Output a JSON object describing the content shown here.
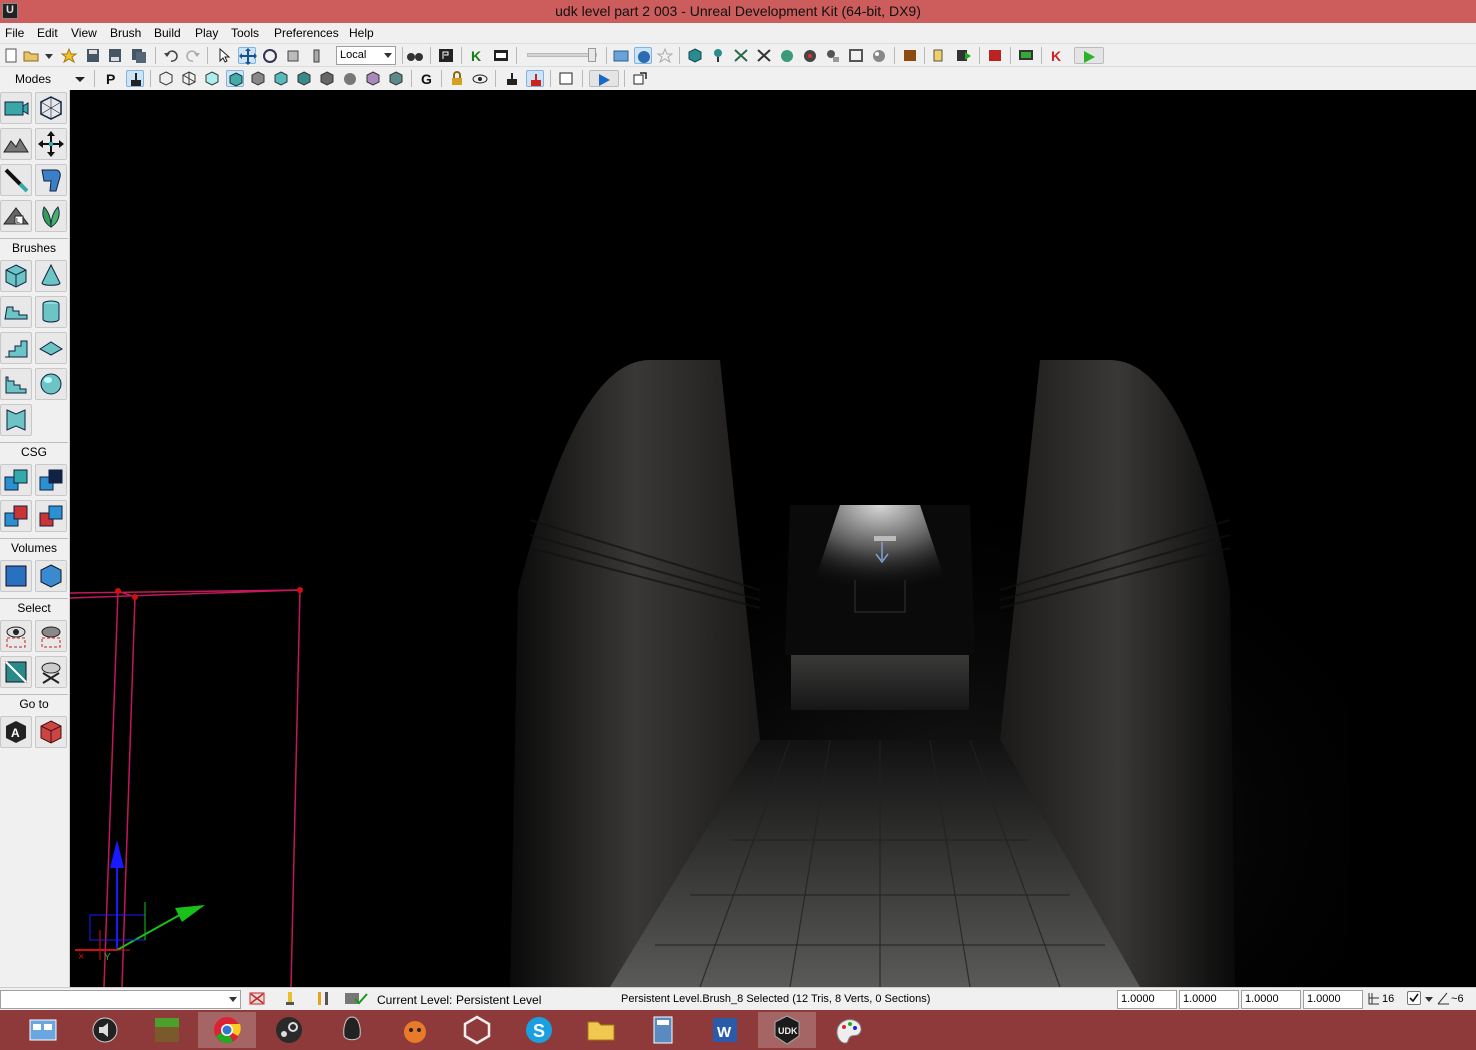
{
  "window": {
    "title": "udk level part 2 003 - Unreal Development Kit (64-bit, DX9)",
    "app_icon": "udk-logo-icon"
  },
  "menu": {
    "items": [
      "File",
      "Edit",
      "View",
      "Brush",
      "Build",
      "Play",
      "Tools",
      "Preferences",
      "Help"
    ]
  },
  "toolbar": {
    "coordinate_system": "Local",
    "modes_label": "Modes"
  },
  "left_panel": {
    "sections": {
      "brushes": "Brushes",
      "csg": "CSG",
      "volumes": "Volumes",
      "select": "Select",
      "goto": "Go to"
    }
  },
  "status_bar": {
    "current_level_label": "Current Level:",
    "current_level_value": "Persistent Level",
    "selection_info": "Persistent Level.Brush_8 Selected (12 Tris, 8 Verts, 0 Sections)",
    "scale_x": "1.0000",
    "scale_y": "1.0000",
    "scale_z": "1.0000",
    "scale_w": "1.0000",
    "grid_size": "16",
    "rotation_snap": "6"
  },
  "taskbar": {
    "apps": [
      "explorer-ui-icon",
      "audio-icon",
      "minecraft-icon",
      "chrome-icon",
      "steam-icon",
      "inkscape-icon",
      "game-icon",
      "unity-icon",
      "skype-icon",
      "file-explorer-icon",
      "calculator-icon",
      "word-icon",
      "udk-icon",
      "paint-icon"
    ],
    "active_app": "udk-icon"
  },
  "colors": {
    "titlebar": "#cd5c5c",
    "taskbar": "#8e3a3a",
    "brush_wireframe": "#c2185b"
  }
}
